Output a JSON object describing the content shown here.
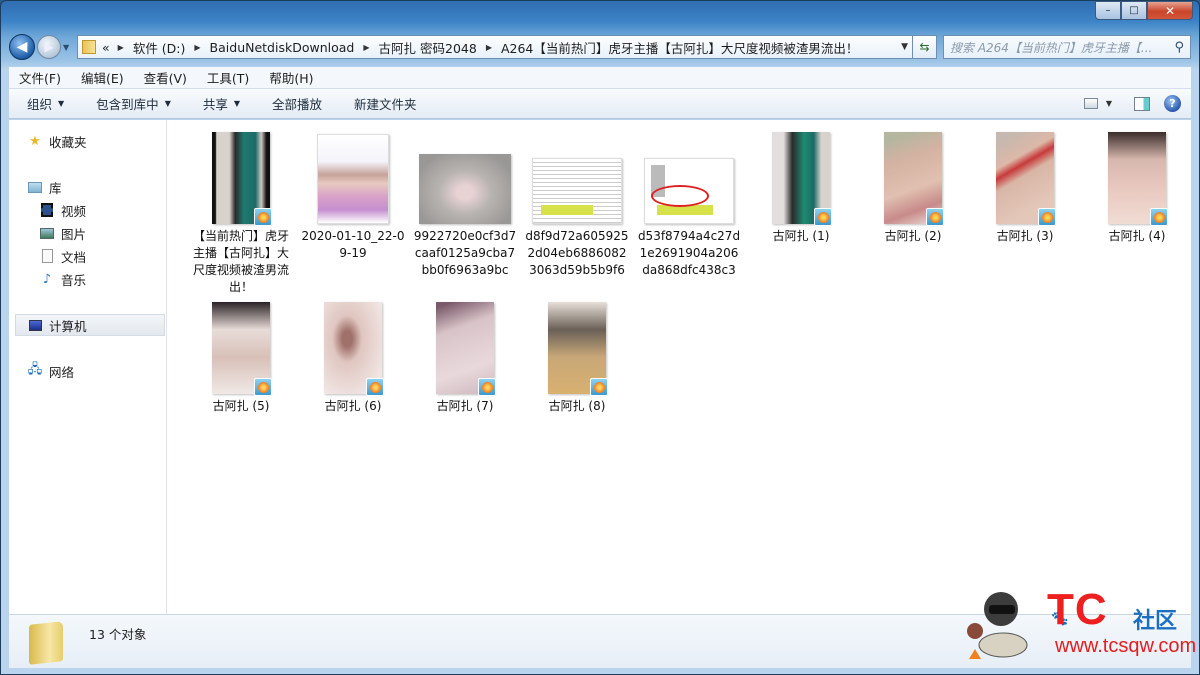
{
  "window": {
    "caption_buttons": {
      "minimize": "–",
      "maximize": "□",
      "close": "✕"
    }
  },
  "nav": {
    "back_icon": "◀",
    "forward_icon": "▶",
    "breadcrumb_overflow": "«",
    "breadcrumb": [
      "软件 (D:)",
      "BaiduNetdiskDownload",
      "古阿扎  密码2048",
      "A264【当前热门】虎牙主播【古阿扎】大尺度视频被渣男流出！"
    ],
    "search_placeholder": "搜索 A264【当前热门】虎牙主播【..."
  },
  "menubar": [
    "文件(F)",
    "编辑(E)",
    "查看(V)",
    "工具(T)",
    "帮助(H)"
  ],
  "commandbar": {
    "organize": "组织",
    "include_in_library": "包含到库中",
    "share": "共享",
    "play_all": "全部播放",
    "new_folder": "新建文件夹"
  },
  "sidebar": {
    "favorites": "收藏夹",
    "libraries": "库",
    "videos": "视频",
    "pictures": "图片",
    "documents": "文档",
    "music": "音乐",
    "computer": "计算机",
    "network": "网络"
  },
  "files": [
    {
      "name": "【当前热门】虎牙主播【古阿扎】大尺度视频被渣男流出！",
      "type": "video"
    },
    {
      "name": "2020-01-10_22-09-19",
      "type": "image"
    },
    {
      "name": "9922720e0cf3d7caaf0125a9cba7bb0f6963a9bc",
      "type": "image"
    },
    {
      "name": "d8f9d72a6059252d04eb68860823063d59b5b9f6",
      "type": "image"
    },
    {
      "name": "d53f8794a4c27d1e2691904a206da868dfc438c3",
      "type": "image"
    },
    {
      "name": "古阿扎 (1)",
      "type": "video"
    },
    {
      "name": "古阿扎 (2)",
      "type": "video"
    },
    {
      "name": "古阿扎 (3)",
      "type": "video"
    },
    {
      "name": "古阿扎 (4)",
      "type": "video"
    },
    {
      "name": "古阿扎 (5)",
      "type": "video"
    },
    {
      "name": "古阿扎 (6)",
      "type": "video"
    },
    {
      "name": "古阿扎 (7)",
      "type": "video"
    },
    {
      "name": "古阿扎 (8)",
      "type": "video"
    }
  ],
  "status": {
    "count_text": "13 个对象"
  },
  "watermark": {
    "brand": "TC",
    "community": "社区",
    "url": "www.tcsqw.com"
  }
}
